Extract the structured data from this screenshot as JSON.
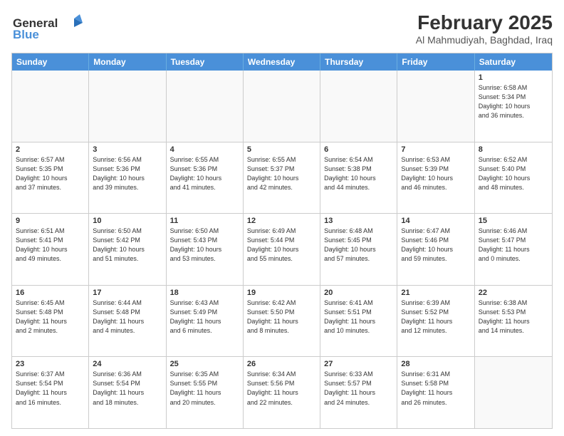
{
  "logo": {
    "line1": "General",
    "line2": "Blue"
  },
  "title": "February 2025",
  "subtitle": "Al Mahmudiyah, Baghdad, Iraq",
  "header_days": [
    "Sunday",
    "Monday",
    "Tuesday",
    "Wednesday",
    "Thursday",
    "Friday",
    "Saturday"
  ],
  "weeks": [
    [
      {
        "day": "",
        "info": ""
      },
      {
        "day": "",
        "info": ""
      },
      {
        "day": "",
        "info": ""
      },
      {
        "day": "",
        "info": ""
      },
      {
        "day": "",
        "info": ""
      },
      {
        "day": "",
        "info": ""
      },
      {
        "day": "1",
        "info": "Sunrise: 6:58 AM\nSunset: 5:34 PM\nDaylight: 10 hours\nand 36 minutes."
      }
    ],
    [
      {
        "day": "2",
        "info": "Sunrise: 6:57 AM\nSunset: 5:35 PM\nDaylight: 10 hours\nand 37 minutes."
      },
      {
        "day": "3",
        "info": "Sunrise: 6:56 AM\nSunset: 5:36 PM\nDaylight: 10 hours\nand 39 minutes."
      },
      {
        "day": "4",
        "info": "Sunrise: 6:55 AM\nSunset: 5:36 PM\nDaylight: 10 hours\nand 41 minutes."
      },
      {
        "day": "5",
        "info": "Sunrise: 6:55 AM\nSunset: 5:37 PM\nDaylight: 10 hours\nand 42 minutes."
      },
      {
        "day": "6",
        "info": "Sunrise: 6:54 AM\nSunset: 5:38 PM\nDaylight: 10 hours\nand 44 minutes."
      },
      {
        "day": "7",
        "info": "Sunrise: 6:53 AM\nSunset: 5:39 PM\nDaylight: 10 hours\nand 46 minutes."
      },
      {
        "day": "8",
        "info": "Sunrise: 6:52 AM\nSunset: 5:40 PM\nDaylight: 10 hours\nand 48 minutes."
      }
    ],
    [
      {
        "day": "9",
        "info": "Sunrise: 6:51 AM\nSunset: 5:41 PM\nDaylight: 10 hours\nand 49 minutes."
      },
      {
        "day": "10",
        "info": "Sunrise: 6:50 AM\nSunset: 5:42 PM\nDaylight: 10 hours\nand 51 minutes."
      },
      {
        "day": "11",
        "info": "Sunrise: 6:50 AM\nSunset: 5:43 PM\nDaylight: 10 hours\nand 53 minutes."
      },
      {
        "day": "12",
        "info": "Sunrise: 6:49 AM\nSunset: 5:44 PM\nDaylight: 10 hours\nand 55 minutes."
      },
      {
        "day": "13",
        "info": "Sunrise: 6:48 AM\nSunset: 5:45 PM\nDaylight: 10 hours\nand 57 minutes."
      },
      {
        "day": "14",
        "info": "Sunrise: 6:47 AM\nSunset: 5:46 PM\nDaylight: 10 hours\nand 59 minutes."
      },
      {
        "day": "15",
        "info": "Sunrise: 6:46 AM\nSunset: 5:47 PM\nDaylight: 11 hours\nand 0 minutes."
      }
    ],
    [
      {
        "day": "16",
        "info": "Sunrise: 6:45 AM\nSunset: 5:48 PM\nDaylight: 11 hours\nand 2 minutes."
      },
      {
        "day": "17",
        "info": "Sunrise: 6:44 AM\nSunset: 5:48 PM\nDaylight: 11 hours\nand 4 minutes."
      },
      {
        "day": "18",
        "info": "Sunrise: 6:43 AM\nSunset: 5:49 PM\nDaylight: 11 hours\nand 6 minutes."
      },
      {
        "day": "19",
        "info": "Sunrise: 6:42 AM\nSunset: 5:50 PM\nDaylight: 11 hours\nand 8 minutes."
      },
      {
        "day": "20",
        "info": "Sunrise: 6:41 AM\nSunset: 5:51 PM\nDaylight: 11 hours\nand 10 minutes."
      },
      {
        "day": "21",
        "info": "Sunrise: 6:39 AM\nSunset: 5:52 PM\nDaylight: 11 hours\nand 12 minutes."
      },
      {
        "day": "22",
        "info": "Sunrise: 6:38 AM\nSunset: 5:53 PM\nDaylight: 11 hours\nand 14 minutes."
      }
    ],
    [
      {
        "day": "23",
        "info": "Sunrise: 6:37 AM\nSunset: 5:54 PM\nDaylight: 11 hours\nand 16 minutes."
      },
      {
        "day": "24",
        "info": "Sunrise: 6:36 AM\nSunset: 5:54 PM\nDaylight: 11 hours\nand 18 minutes."
      },
      {
        "day": "25",
        "info": "Sunrise: 6:35 AM\nSunset: 5:55 PM\nDaylight: 11 hours\nand 20 minutes."
      },
      {
        "day": "26",
        "info": "Sunrise: 6:34 AM\nSunset: 5:56 PM\nDaylight: 11 hours\nand 22 minutes."
      },
      {
        "day": "27",
        "info": "Sunrise: 6:33 AM\nSunset: 5:57 PM\nDaylight: 11 hours\nand 24 minutes."
      },
      {
        "day": "28",
        "info": "Sunrise: 6:31 AM\nSunset: 5:58 PM\nDaylight: 11 hours\nand 26 minutes."
      },
      {
        "day": "",
        "info": ""
      }
    ]
  ]
}
